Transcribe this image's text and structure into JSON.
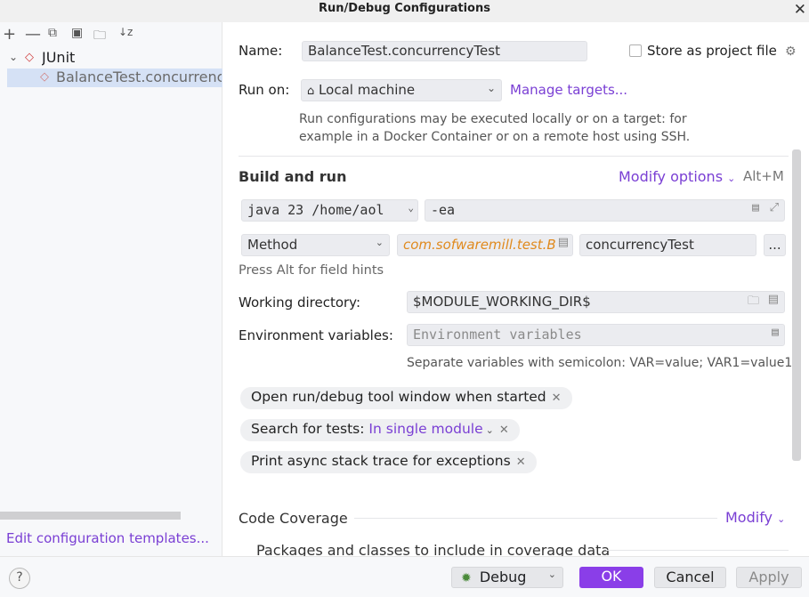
{
  "window": {
    "title": "Run/Debug Configurations"
  },
  "tree": {
    "root_label": "JUnit",
    "item_label": "BalanceTest.concurrenc"
  },
  "left_footer": {
    "edit_templates": "Edit configuration templates..."
  },
  "form": {
    "name_label": "Name:",
    "name_value": "BalanceTest.concurrencyTest",
    "store_label": "Store as project file",
    "run_on_label": "Run on:",
    "run_on_value": "Local machine",
    "manage_targets": "Manage targets...",
    "run_on_hint_1": "Run configurations may be executed locally or on a target: for",
    "run_on_hint_2": "example in a Docker Container or on a remote host using SSH.",
    "build_run_title": "Build and run",
    "modify_options": "Modify options",
    "modify_shortcut": "Alt+M",
    "jdk_value": "java 23 /home/aol",
    "vm_options": "-ea",
    "test_kind": "Method",
    "class_value": "com.sofwaremill.test.B",
    "method_value": "concurrencyTest",
    "ellipsis": "...",
    "field_hints": "Press Alt for field hints",
    "workdir_label": "Working directory:",
    "workdir_value": "$MODULE_WORKING_DIR$",
    "env_label": "Environment variables:",
    "env_placeholder": "Environment variables",
    "env_hint": "Separate variables with semicolon: VAR=value; VAR1=value1",
    "chip_open_tool": "Open run/debug tool window when started",
    "chip_search_label": "Search for tests:",
    "chip_search_value": "In single module",
    "chip_async": "Print async stack trace for exceptions",
    "coverage_title": "Code Coverage",
    "coverage_modify": "Modify",
    "coverage_sub": "Packages and classes to include in coverage data"
  },
  "buttons": {
    "help": "?",
    "debug": "Debug",
    "ok": "OK",
    "cancel": "Cancel",
    "apply": "Apply"
  },
  "colors": {
    "accent": "#7a3fd4",
    "ok_button": "#8a3ee8",
    "class_text": "#e08a1e"
  }
}
